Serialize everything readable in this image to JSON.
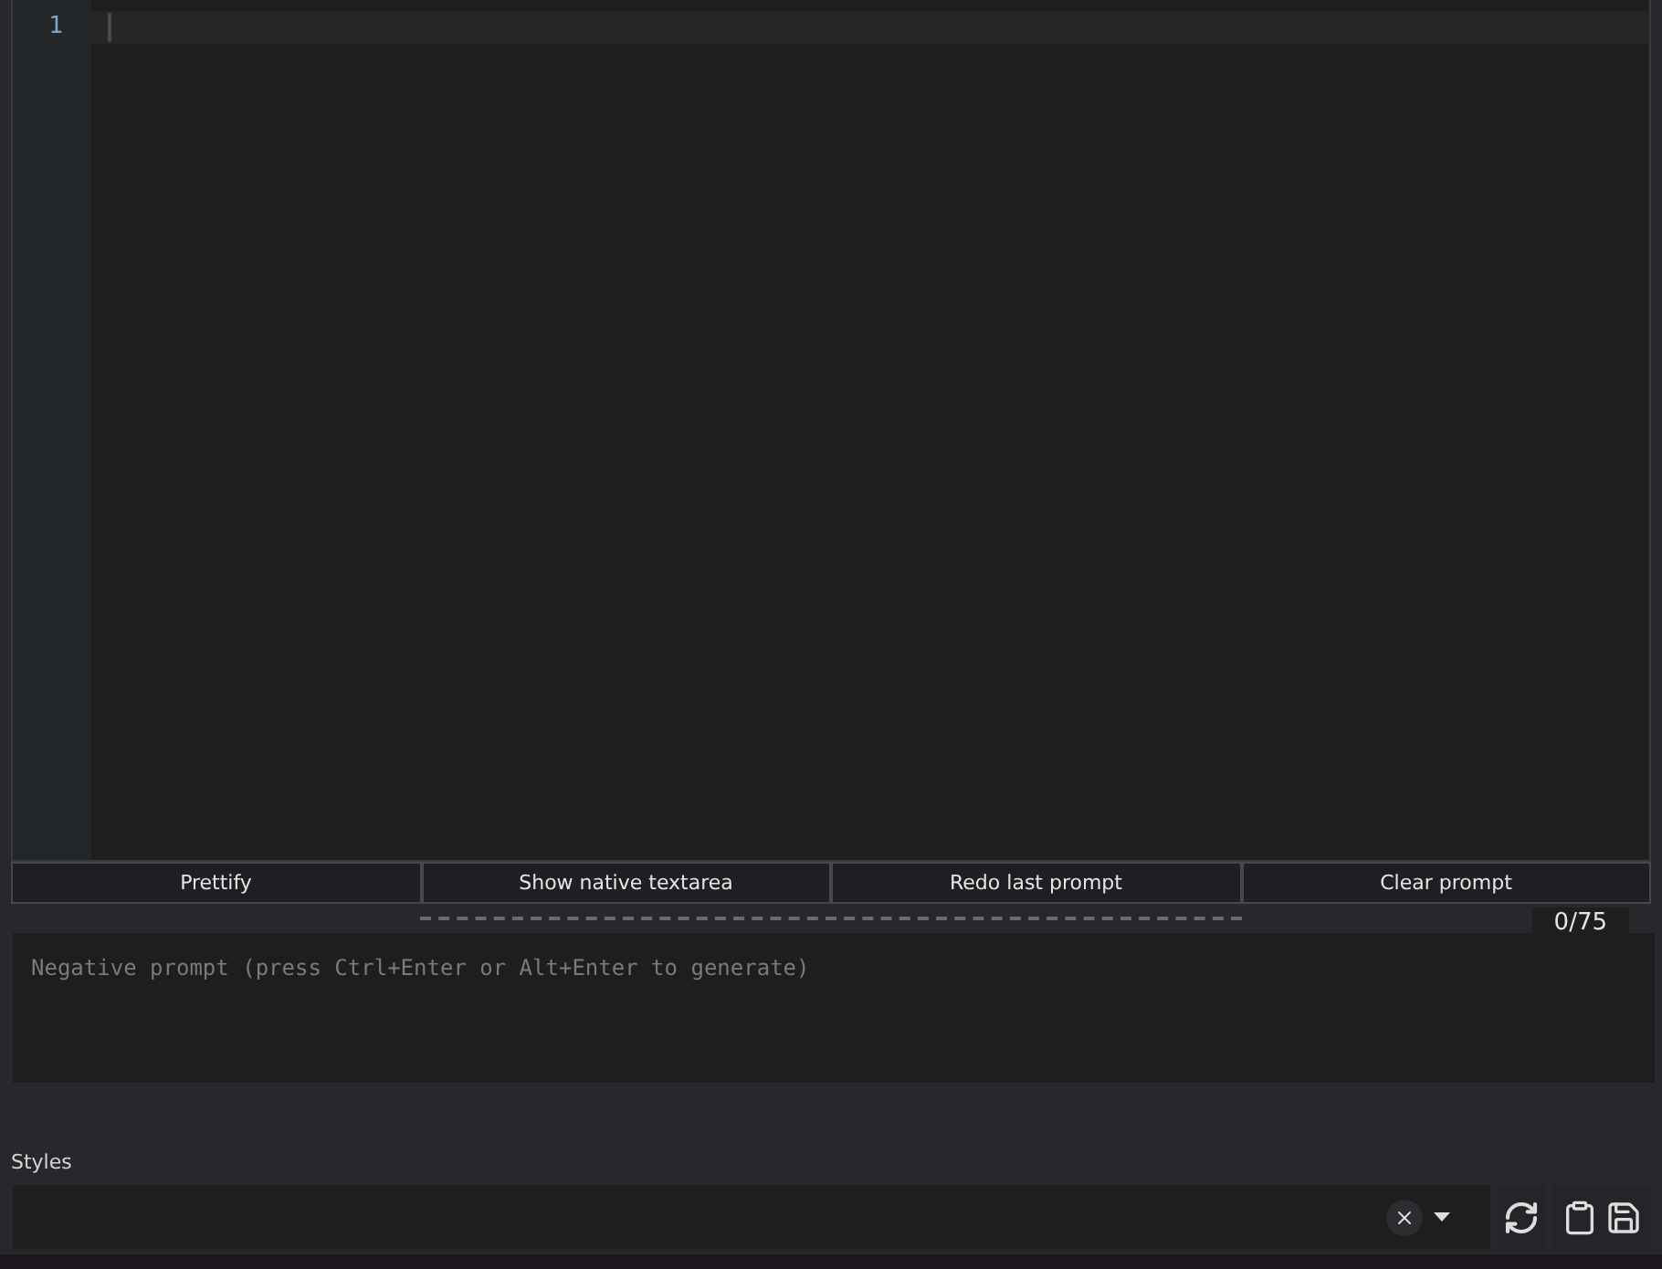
{
  "editor": {
    "line_numbers": [
      "1"
    ]
  },
  "buttons": [
    "Prettify",
    "Show native textarea",
    "Redo last prompt",
    "Clear prompt"
  ],
  "token_counter": "0/75",
  "negative_prompt": {
    "placeholder": "Negative prompt (press Ctrl+Enter or Alt+Enter to generate)"
  },
  "styles": {
    "label": "Styles"
  }
}
